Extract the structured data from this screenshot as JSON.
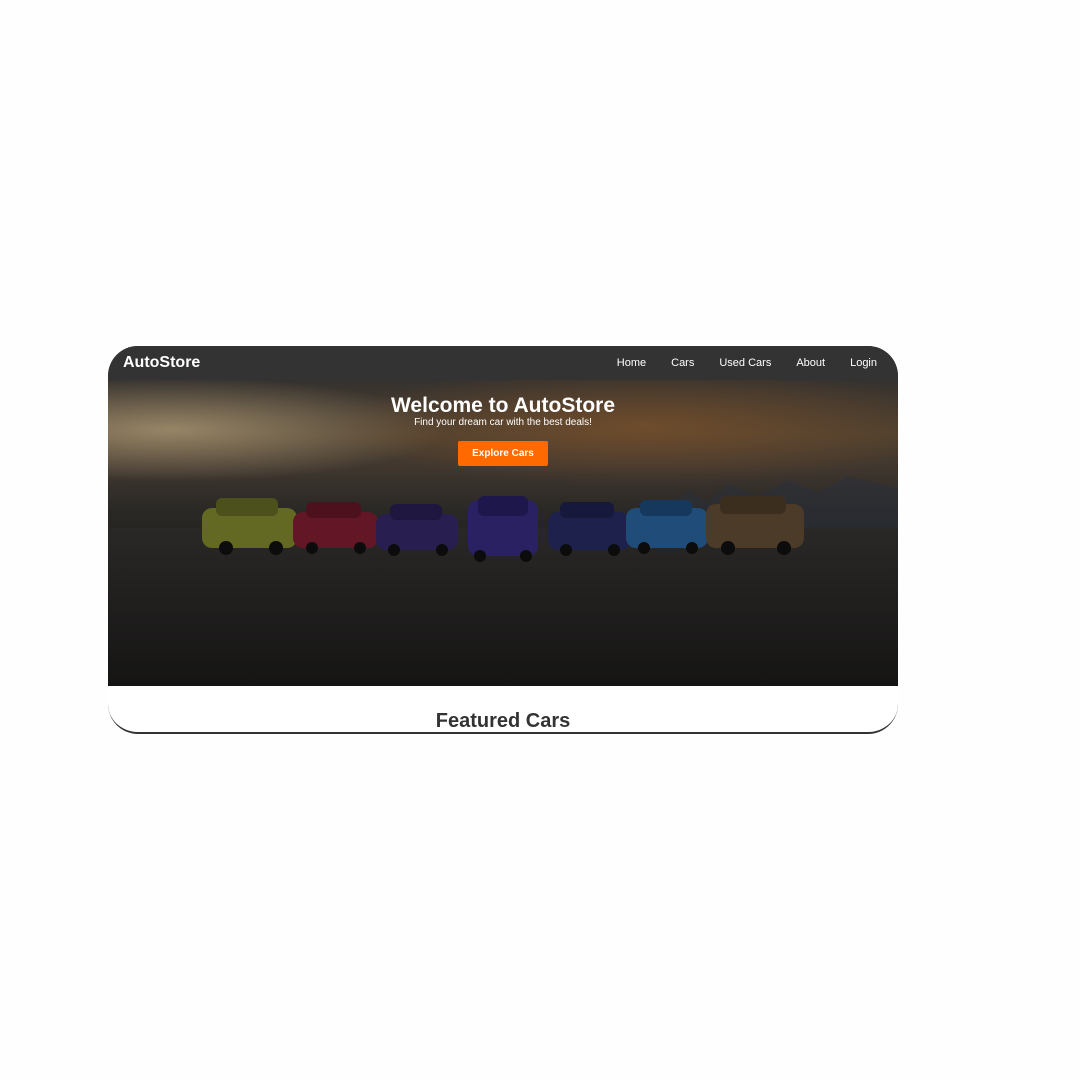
{
  "navbar": {
    "brand": "AutoStore",
    "links": [
      "Home",
      "Cars",
      "Used Cars",
      "About",
      "Login"
    ]
  },
  "hero": {
    "title": "Welcome to AutoStore",
    "subtitle": "Find your dream car with the best deals!",
    "cta_label": "Explore Cars",
    "image_desc_icon": "car-lineup-image"
  },
  "featured": {
    "title": "Featured Cars"
  },
  "colors": {
    "navbar_bg": "#333333",
    "cta_bg": "#ff6a00",
    "heading_text": "#333333"
  }
}
